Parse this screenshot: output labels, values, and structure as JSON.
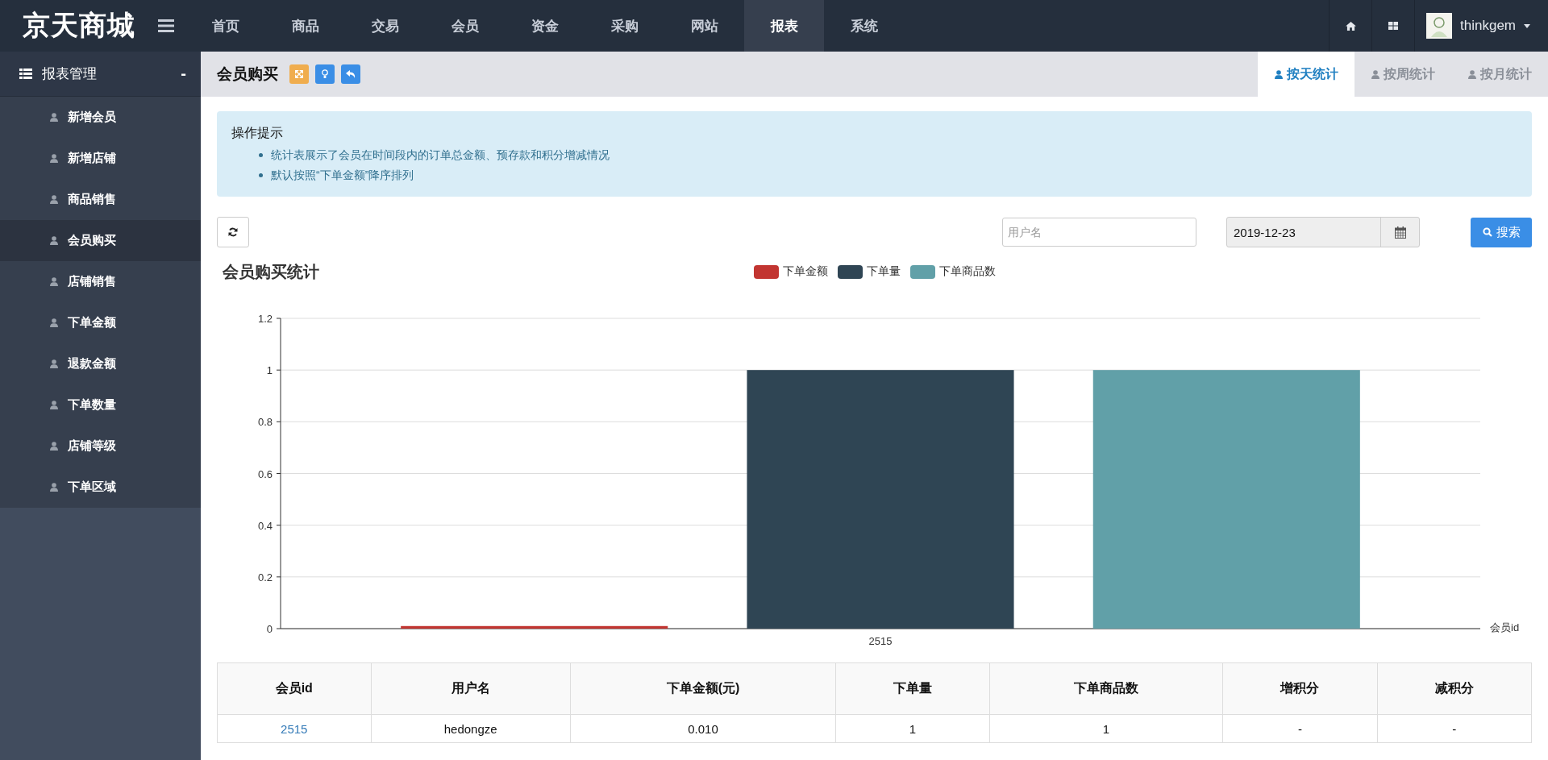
{
  "brand": "京天商城",
  "nav": [
    {
      "label": "首页",
      "selected": false
    },
    {
      "label": "商品",
      "selected": false
    },
    {
      "label": "交易",
      "selected": false
    },
    {
      "label": "会员",
      "selected": false
    },
    {
      "label": "资金",
      "selected": false
    },
    {
      "label": "采购",
      "selected": false
    },
    {
      "label": "网站",
      "selected": false
    },
    {
      "label": "报表",
      "selected": true
    },
    {
      "label": "系统",
      "selected": false
    }
  ],
  "user": {
    "name": "thinkgem"
  },
  "sidebar": {
    "title": "报表管理",
    "collapse": "-",
    "items": [
      {
        "label": "新增会员",
        "selected": false
      },
      {
        "label": "新增店铺",
        "selected": false
      },
      {
        "label": "商品销售",
        "selected": false
      },
      {
        "label": "会员购买",
        "selected": true
      },
      {
        "label": "店铺销售",
        "selected": false
      },
      {
        "label": "下单金额",
        "selected": false
      },
      {
        "label": "退款金额",
        "selected": false
      },
      {
        "label": "下单数量",
        "selected": false
      },
      {
        "label": "店铺等级",
        "selected": false
      },
      {
        "label": "下单区域",
        "selected": false
      }
    ]
  },
  "page": {
    "title": "会员购买",
    "tabs": [
      {
        "label": "按天统计",
        "selected": true
      },
      {
        "label": "按周统计",
        "selected": false
      },
      {
        "label": "按月统计",
        "selected": false
      }
    ]
  },
  "hint": {
    "title": "操作提示",
    "items": [
      "统计表展示了会员在时间段内的订单总金额、预存款和积分增减情况",
      "默认按照“下单金额”降序排列"
    ]
  },
  "filters": {
    "username": {
      "placeholder": "用户名"
    },
    "date": {
      "value": "2019-12-23"
    },
    "search_button": "搜索"
  },
  "chart_data": {
    "type": "bar",
    "title": "会员购买统计",
    "xlabel": "会员id",
    "categories": [
      "2515"
    ],
    "series": [
      {
        "name": "下单金额",
        "color": "#c23531",
        "values": [
          0.01
        ]
      },
      {
        "name": "下单量",
        "color": "#2f4554",
        "values": [
          1
        ]
      },
      {
        "name": "下单商品数",
        "color": "#61a0a8",
        "values": [
          1
        ]
      }
    ],
    "grid": true,
    "ylim": [
      0,
      1.2
    ],
    "yticks": [
      0,
      0.2,
      0.4,
      0.6,
      0.8,
      1,
      1.2
    ]
  },
  "table": {
    "columns": [
      "会员id",
      "用户名",
      "下单金额(元)",
      "下单量",
      "下单商品数",
      "增积分",
      "减积分"
    ],
    "rows": [
      [
        "2515",
        "hedongze",
        "0.010",
        "1",
        "1",
        "-",
        "-"
      ]
    ]
  }
}
